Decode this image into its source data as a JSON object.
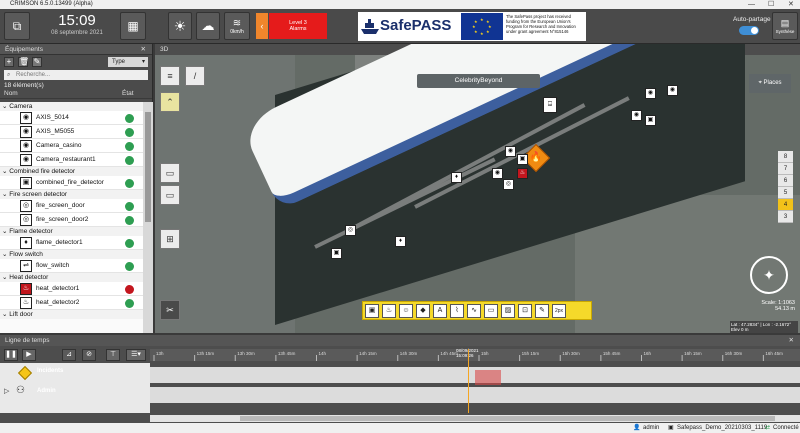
{
  "window": {
    "title": "CRIMSON 6.5.0.13499 (Alpha)",
    "controls": [
      "—",
      "☐",
      "✕"
    ]
  },
  "topbar": {
    "time": "15:09",
    "date": "08 septembre 2021",
    "weather_label": "0km/h",
    "alarm": {
      "line1": "Level 3",
      "line2": "Alarms"
    },
    "safepass": {
      "name": "SafePASS",
      "funding_text": "The SafePass project has received funding from the European Union's Program for Research and Innovation under grant agreement N°815146"
    },
    "auto_partage_label": "Auto-partage",
    "auto_partage_on": true,
    "synthese_label": "Synthèse"
  },
  "equipment_panel": {
    "title": "Équipements",
    "type_label": "Type",
    "search_placeholder": "Recherche...",
    "count": "18 élément(s)",
    "col_name": "Nom",
    "col_state": "État",
    "groups": [
      {
        "label": "Camera",
        "items": [
          {
            "name": "AXIS_5014",
            "icon": "camera-icon",
            "status": "ok"
          },
          {
            "name": "AXIS_M5055",
            "icon": "camera-icon",
            "status": "ok"
          },
          {
            "name": "Camera_casino",
            "icon": "camera-icon",
            "status": "ok"
          },
          {
            "name": "Camera_restaurant1",
            "icon": "camera-icon",
            "status": "ok"
          }
        ]
      },
      {
        "label": "Combined fire detector",
        "items": [
          {
            "name": "combined_fire_detector",
            "icon": "fire-detector-icon",
            "status": "ok"
          }
        ]
      },
      {
        "label": "Fire screen detector",
        "items": [
          {
            "name": "fire_screen_door",
            "icon": "fire-screen-icon",
            "status": "ok"
          },
          {
            "name": "fire_screen_door2",
            "icon": "fire-screen-icon",
            "status": "ok"
          }
        ]
      },
      {
        "label": "Flame detector",
        "items": [
          {
            "name": "flame_detector1",
            "icon": "flame-icon",
            "status": "ok"
          }
        ]
      },
      {
        "label": "Flow switch",
        "items": [
          {
            "name": "flow_switch",
            "icon": "flow-switch-icon",
            "status": "ok"
          }
        ]
      },
      {
        "label": "Heat detector",
        "items": [
          {
            "name": "heat_detector1",
            "icon": "heat-detector-icon",
            "status": "alarm"
          },
          {
            "name": "heat_detector2",
            "icon": "heat-detector-icon",
            "status": "ok"
          }
        ]
      },
      {
        "label": "Lift door",
        "items": []
      }
    ]
  },
  "view3d": {
    "title": "3D",
    "ship_name": "CelebrityBeyond",
    "places_label": "Places",
    "floors": [
      "8",
      "7",
      "6",
      "5",
      "4",
      "3"
    ],
    "selected_floor": "4",
    "scale": "Scale: 1:1063",
    "scale_distance": "54.13 m",
    "coords": "Lat : 47.2834° | Lon : -2.1672° Elev 0 m"
  },
  "timeline": {
    "title": "Ligne de temps",
    "cursor_date": "08/09/2021",
    "cursor_time": "15:09:26",
    "lanes": [
      {
        "label": "Incidents",
        "icon": "incident-icon"
      },
      {
        "label": "Admin",
        "icon": "users-icon"
      }
    ],
    "ticks": [
      "13h",
      "13h 15m",
      "13h 30m",
      "13h 45m",
      "14h",
      "14h 15m",
      "14h 30m",
      "14h 45m",
      "15h",
      "15h 15m",
      "15h 30m",
      "15h 45m",
      "16h",
      "16h 15m",
      "16h 30m",
      "16h 45m"
    ]
  },
  "statusbar": {
    "user": "admin",
    "project": "Safepass_Demo_20210303_1119",
    "connection": "Connecté"
  },
  "colors": {
    "alarm_red": "#e51b1b",
    "alarm_orange": "#f0862c",
    "ok_green": "#2e9e52",
    "floor_selected": "#f2c21a",
    "toggle_blue": "#3f8fd6"
  }
}
